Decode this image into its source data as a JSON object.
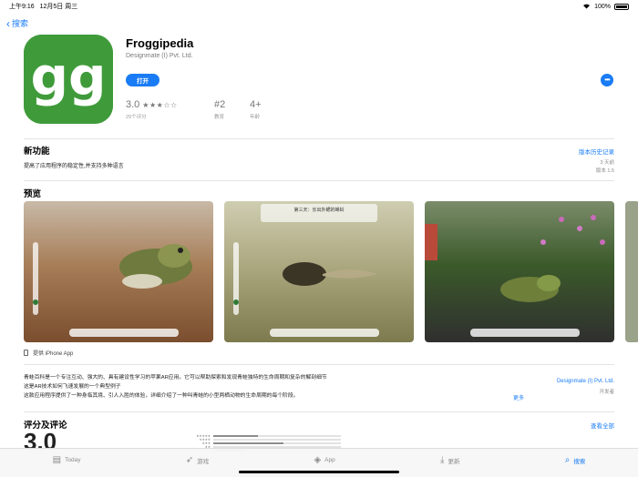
{
  "status": {
    "time": "上午9:16",
    "date": "12月5日 周三",
    "battery": "100%"
  },
  "nav": {
    "back_label": "搜索"
  },
  "app": {
    "title": "Froggipedia",
    "developer": "Designmate (I) Pvt. Ltd.",
    "open_label": "打开",
    "more_label": "•••"
  },
  "stats": {
    "rating_value": "3.0",
    "rating_stars": "★★★☆☆",
    "rating_count": "29个评分",
    "rank_value": "#2",
    "rank_label": "教育",
    "age_value": "4+",
    "age_label": "年龄"
  },
  "whats_new": {
    "title": "新功能",
    "history_link": "版本历史记录",
    "note": "提高了应用程序的稳定性,并支持多种语言",
    "days_ago": "3 天前",
    "version": "版本 1.5"
  },
  "preview": {
    "title": "预览",
    "caption2": "第三天：长出外鳃的蝌蚪",
    "device_label": "提供 iPhone App"
  },
  "description": {
    "line1": "青蛙百科是一个专注互动、强大的、具有建设性学习的苹果AR应用。它可以帮助探索和发现青蛙独特的生命周期和复杂的解剖细节",
    "line2": "这是AR技术如何飞速发展的一个典型例子",
    "line3": "这款应用程序提供了一种身临其境、引人入胜的体验，详细介绍了一种叫青蛙的小型两栖动物的生命周期的每个阶段。",
    "more_link": "更多",
    "developer_link": "Designmate (I) Pvt. Ltd.",
    "developer_role": "开发者"
  },
  "ratings": {
    "title": "评分及评论",
    "see_all": "查看全部",
    "big_value": "3.0",
    "distribution": [
      0.35,
      0.0,
      0.55,
      0.0,
      0.25
    ]
  },
  "tabbar": {
    "tabs": [
      {
        "label": "Today",
        "icon": "today-icon"
      },
      {
        "label": "游戏",
        "icon": "rocket-icon"
      },
      {
        "label": "App",
        "icon": "layers-icon"
      },
      {
        "label": "更新",
        "icon": "download-icon"
      },
      {
        "label": "搜索",
        "icon": "search-icon"
      }
    ]
  },
  "colors": {
    "accent": "#1a7cf5",
    "icon_green": "#3f9b3a"
  }
}
